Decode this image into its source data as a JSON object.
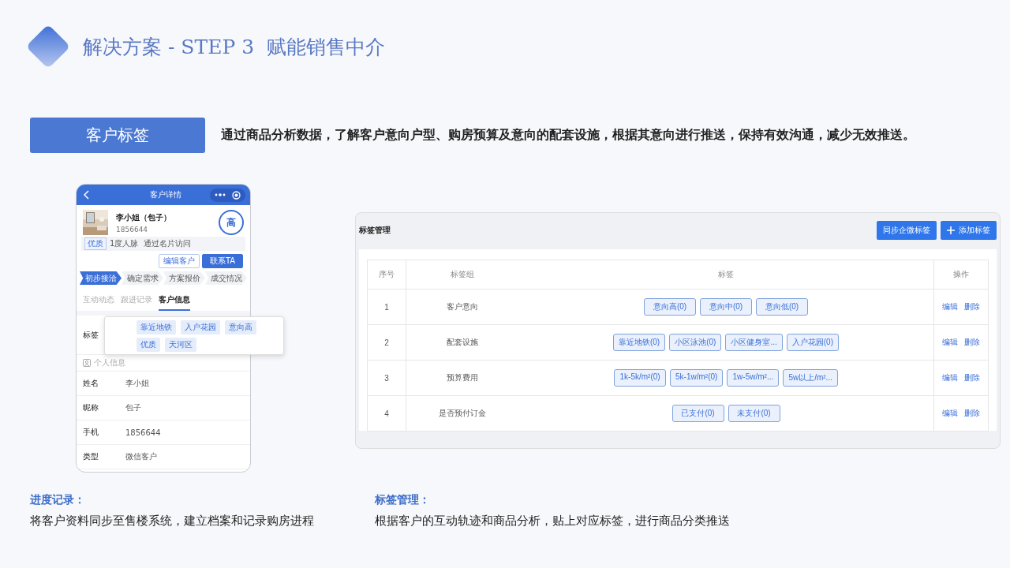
{
  "header": {
    "title": "解决方案 - STEP 3  赋能销售中介"
  },
  "feature": {
    "label": "客户标签",
    "description": "通过商品分析数据，了解客户意向户型、购房预算及意向的配套设施，根据其意向进行推送，保持有效沟通，减少无效推送。"
  },
  "phone": {
    "title": "客户详情",
    "customer": {
      "name": "李小姐（包子）",
      "phone": "1856644",
      "intent": "高"
    },
    "badge": "优质",
    "source": "1度人脉  通过名片访问",
    "buttons": [
      {
        "label": "编辑客户",
        "kind": "outline"
      },
      {
        "label": "联系TA",
        "kind": "primary"
      }
    ],
    "steps": [
      {
        "label": "初步接洽",
        "selected": true
      },
      {
        "label": "确定需求",
        "selected": false
      },
      {
        "label": "方案报价",
        "selected": false
      },
      {
        "label": "成交情况",
        "selected": false
      }
    ],
    "tabs": [
      {
        "label": "互动动态",
        "selected": false
      },
      {
        "label": "跟进记录",
        "selected": false
      },
      {
        "label": "客户信息",
        "selected": true
      }
    ],
    "tag_label": "标签",
    "tags": [
      "靠近地铁",
      "入户花园",
      "意向高",
      "优质",
      "天河区"
    ],
    "section": "个人信息",
    "fields": [
      {
        "label": "姓名",
        "value": "李小姐"
      },
      {
        "label": "昵称",
        "value": "包子"
      },
      {
        "label": "手机",
        "value": "1856644"
      },
      {
        "label": "类型",
        "value": "微信客户"
      }
    ]
  },
  "tag_manager": {
    "title": "标签管理",
    "buttons": [
      {
        "label": "同步企微标签",
        "kind": "sync"
      },
      {
        "label": "添加标签",
        "kind": "add"
      }
    ],
    "columns": [
      "序号",
      "标签组",
      "标签",
      "操作"
    ],
    "rows": [
      {
        "index": "1",
        "group": "客户意向",
        "tags": [
          "意向高(0)",
          "意向中(0)",
          "意向低(0)"
        ],
        "actions": [
          "编辑",
          "删除"
        ]
      },
      {
        "index": "2",
        "group": "配套设施",
        "tags": [
          "靠近地铁(0)",
          "小区泳池(0)",
          "小区健身室...",
          "入户花园(0)"
        ],
        "actions": [
          "编辑",
          "删除"
        ]
      },
      {
        "index": "3",
        "group": "预算费用",
        "tags": [
          "1k-5k/m²(0)",
          "5k-1w/m²(0)",
          "1w-5w/m²...",
          "5w以上/m²..."
        ],
        "actions": [
          "编辑",
          "删除"
        ]
      },
      {
        "index": "4",
        "group": "是否预付订金",
        "tags": [
          "已支付(0)",
          "未支付(0)"
        ],
        "actions": [
          "编辑",
          "删除"
        ]
      }
    ]
  },
  "captions": [
    {
      "title": "进度记录：",
      "text": "将客户资料同步至售楼系统，建立档案和记录购房进程"
    },
    {
      "title": "标签管理：",
      "text": "根据客户的互动轨迹和商品分析，贴上对应标签，进行商品分类推送"
    }
  ]
}
